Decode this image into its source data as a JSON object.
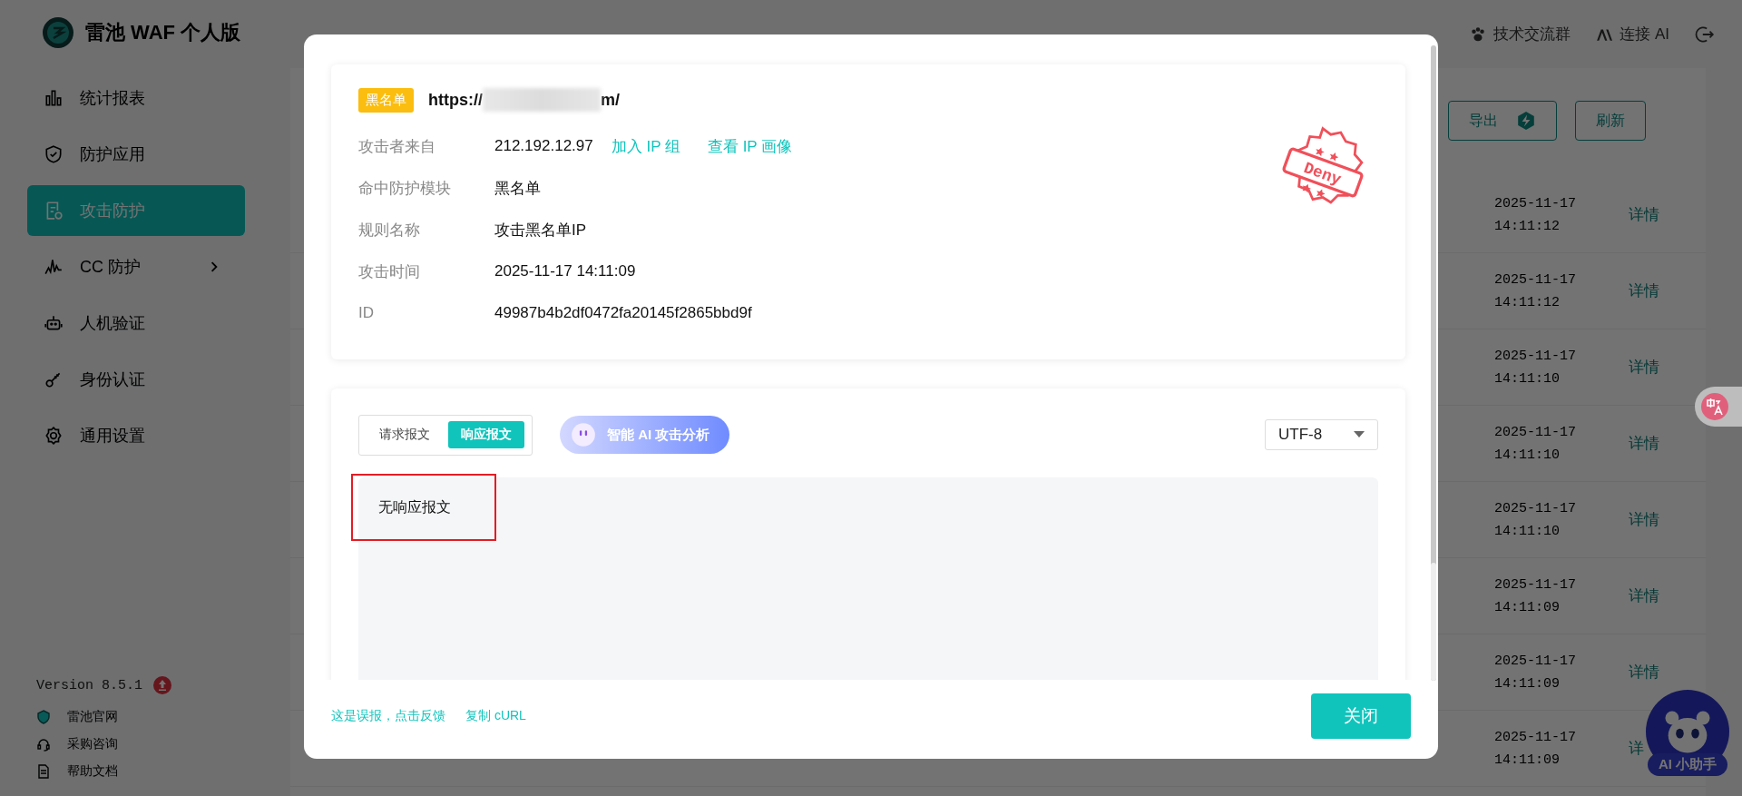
{
  "topbar": {
    "product": "雷池 WAF 个人版",
    "community": "技术交流群",
    "connect_ai": "连接 AI"
  },
  "sidebar": {
    "items": [
      {
        "kind": "chart",
        "label": "统计报表",
        "selected": false
      },
      {
        "kind": "shield",
        "label": "防护应用",
        "selected": false
      },
      {
        "kind": "doc",
        "label": "攻击防护",
        "selected": true
      },
      {
        "kind": "pulse",
        "label": "CC 防护",
        "selected": false,
        "expandable": true
      },
      {
        "kind": "robot",
        "label": "人机验证",
        "selected": false
      },
      {
        "kind": "key",
        "label": "身份认证",
        "selected": false
      },
      {
        "kind": "gear",
        "label": "通用设置",
        "selected": false
      }
    ],
    "version": "Version 8.5.1",
    "update_available": true,
    "links": [
      {
        "kind": "logo",
        "label": "雷池官网"
      },
      {
        "kind": "headset",
        "label": "采购咨询"
      },
      {
        "kind": "file",
        "label": "帮助文档"
      }
    ]
  },
  "toolbar": {
    "buttons": [
      {
        "kind": "export",
        "label": "导出"
      },
      {
        "kind": "plain",
        "label": "刷新"
      }
    ]
  },
  "table": {
    "rows": [
      {
        "date": "2025-11-17",
        "time": "14:11:12",
        "action": "详情"
      },
      {
        "date": "2025-11-17",
        "time": "14:11:12",
        "action": "详情"
      },
      {
        "date": "2025-11-17",
        "time": "14:11:10",
        "action": "详情"
      },
      {
        "date": "2025-11-17",
        "time": "14:11:10",
        "action": "详情"
      },
      {
        "date": "2025-11-17",
        "time": "14:11:10",
        "action": "详情"
      },
      {
        "date": "2025-11-17",
        "time": "14:11:09",
        "action": "详情"
      },
      {
        "date": "2025-11-17",
        "time": "14:11:09",
        "action": "详情"
      },
      {
        "date": "2025-11-17",
        "time": "14:11:09",
        "action": "详"
      }
    ]
  },
  "ai_helper": {
    "label": "AI 小助手"
  },
  "modal": {
    "tag": "黑名单",
    "url_start": "https://",
    "url_end": "m/",
    "url_redacted": true,
    "fields": [
      {
        "label": "攻击者来自",
        "value": "212.192.12.97",
        "links": [
          "加入 IP 组",
          "查看 IP 画像"
        ]
      },
      {
        "label": "命中防护模块",
        "value": "黑名单"
      },
      {
        "label": "规则名称",
        "value": "攻击黑名单IP"
      },
      {
        "label": "攻击时间",
        "value": "2025-11-17 14:11:09"
      },
      {
        "label": "ID",
        "value": "49987b4b2df0472fa20145f2865bbd9f"
      }
    ],
    "stamp": "Deny",
    "tabs": [
      {
        "label": "请求报文",
        "selected": false
      },
      {
        "label": "响应报文",
        "selected": true
      }
    ],
    "ai_button": "智能 AI 攻击分析",
    "encoding": "UTF-8",
    "content": {
      "text": "无响应报文",
      "highlighted": true
    },
    "footer_links": [
      "这是误报，点击反馈",
      "复制 cURL"
    ],
    "close": "关闭"
  }
}
